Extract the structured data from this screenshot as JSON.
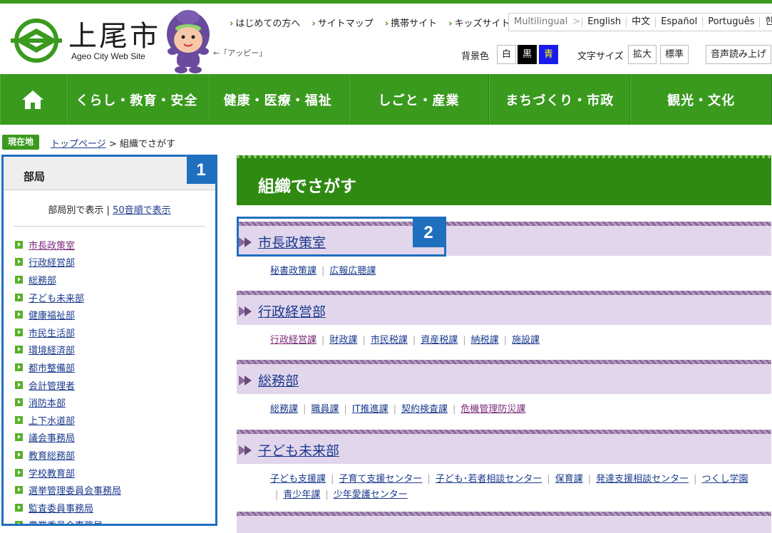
{
  "header": {
    "site_title": "上尾市",
    "site_subtitle": "Ageo City Web Site",
    "mascot_caption": "←「アッピー」",
    "top_links": [
      "はじめての方へ",
      "サイトマップ",
      "携帯サイト",
      "キッズサイト"
    ],
    "languages": [
      "Multilingual",
      "English",
      "中文",
      "Español",
      "Português",
      "한국어"
    ],
    "bgcolor_label": "背景色",
    "bgcolor_options": [
      "白",
      "黒",
      "青"
    ],
    "fontsize_label": "文字サイズ",
    "fontsize_enlarge": "拡大",
    "fontsize_standard": "標準",
    "voice_button": "音声読み上げ"
  },
  "nav": {
    "items": [
      "くらし・教育・安全",
      "健康・医療・福祉",
      "しごと・産業",
      "まちづくり・市政",
      "観光・文化"
    ]
  },
  "breadcrumb": {
    "badge": "現在地",
    "home": "トップページ",
    "separator": ">",
    "current": "組織でさがす"
  },
  "sidebar": {
    "title": "部局",
    "badge": "1",
    "view_by_dept": "部局別で表示",
    "view_sep": "|",
    "view_by_kana": "50音順で表示",
    "items": [
      "市長政策室",
      "行政経営部",
      "総務部",
      "子ども未来部",
      "健康福祉部",
      "市民生活部",
      "環境経済部",
      "都市整備部",
      "会計管理者",
      "消防本部",
      "上下水道部",
      "議会事務局",
      "教育総務部",
      "学校教育部",
      "選挙管理委員会事務局",
      "監査委員事務局",
      "農業委員会事務局"
    ]
  },
  "main": {
    "title": "組織でさがす",
    "highlight_badge": "2",
    "sections": [
      {
        "title": "市長政策室",
        "links": [
          "秘書政策課",
          "広報広聴課"
        ]
      },
      {
        "title": "行政経営部",
        "links": [
          "行政経営課",
          "財政課",
          "市民税課",
          "資産税課",
          "納税課",
          "施設課"
        ]
      },
      {
        "title": "総務部",
        "links": [
          "総務課",
          "職員課",
          "IT推進課",
          "契約検査課",
          "危機管理防災課"
        ]
      },
      {
        "title": "子ども未来部",
        "links": [
          "子ども支援課",
          "子育て支援センター",
          "子ども･若者相談センター",
          "保育課",
          "発達支援相談センター",
          "つくし学園",
          "青少年課",
          "少年愛護センター"
        ]
      }
    ]
  },
  "colors": {
    "brand_green": "#3a9a1e",
    "title_green": "#2f8a12",
    "section_purple": "#e2d6ec",
    "highlight_blue": "#1f6fbf"
  }
}
